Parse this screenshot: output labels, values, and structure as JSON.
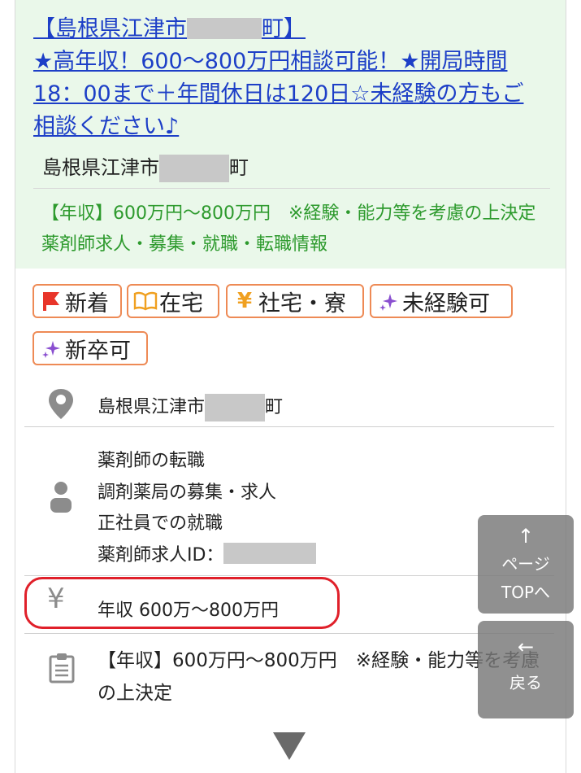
{
  "listing": {
    "title_prefix": "【島根県江津市",
    "title_suffix": "町】",
    "title_rest": "★高年収！600〜800万円相談可能！★開局時間18：00まで＋年間休日は120日☆未経験の方もご相談ください♪",
    "area_prefix": "島根県江津市",
    "area_suffix": "町",
    "salary_note": "【年収】600万円〜800万円　※経験・能力等を考慮の上決定 薬剤師求人・募集・就職・転職情報"
  },
  "tags": [
    {
      "label": "新着",
      "icon": "flag-icon"
    },
    {
      "label": "在宅",
      "icon": "book-icon"
    },
    {
      "label": "社宅・寮",
      "icon": "yen-icon"
    },
    {
      "label": "未経験可",
      "icon": "sparkle-icon"
    },
    {
      "label": "新卒可",
      "icon": "sparkle-icon"
    }
  ],
  "details": {
    "location_prefix": "島根県江津市",
    "location_suffix": "町",
    "job_lines": [
      "薬剤師の転職",
      "調剤薬局の募集・求人",
      "正社員での就職"
    ],
    "job_id_label": "薬剤師求人ID：",
    "salary": "年収 600万〜800万円",
    "salary_detail": "【年収】600万円〜800万円　※経験・能力等を考慮の上決定"
  },
  "floating": {
    "top_arrow": "↑",
    "top_label_1": "ページ",
    "top_label_2": "TOPへ",
    "back_arrow": "←",
    "back_label": "戻る"
  },
  "colors": {
    "link": "#1d3fc7",
    "green_text": "#2d9a2d",
    "tag_border": "#ee8a55",
    "highlight": "#e0202a"
  }
}
